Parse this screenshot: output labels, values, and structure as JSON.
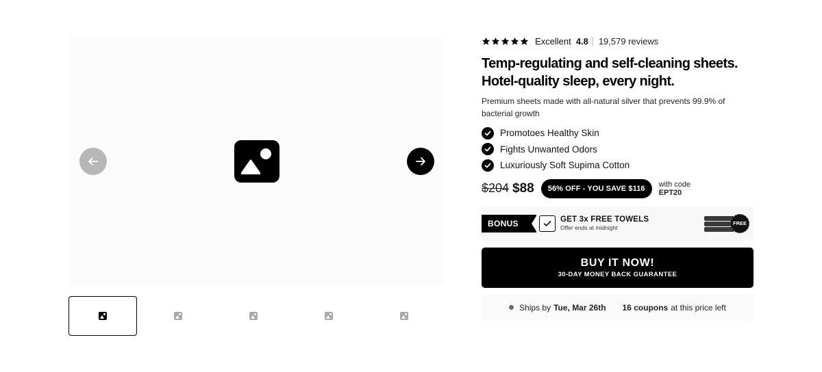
{
  "gallery": {
    "thumbnails": [
      {
        "active": true
      },
      {
        "active": false
      },
      {
        "active": false
      },
      {
        "active": false
      },
      {
        "active": false
      }
    ]
  },
  "rating": {
    "stars": 5,
    "word": "Excellent",
    "score": "4.8",
    "count": "19,579 reviews"
  },
  "product": {
    "title_line1": "Temp-regulating and self-cleaning sheets.",
    "title_line2": "Hotel-quality sleep, every night.",
    "subtitle": "Premium sheets made with all-natural silver that prevents 99.9% of bacterial growth",
    "benefits": [
      "Promotoes Healthy Skin",
      "Fights Unwanted Odors",
      "Luxuriously Soft Supima Cotton"
    ]
  },
  "pricing": {
    "old_price": "$204",
    "new_price": "$88",
    "savings": "56% OFF - YOU SAVE $116",
    "code_prefix": "with code",
    "code": "EPT20"
  },
  "bonus": {
    "tag": "BONUS",
    "checked": true,
    "title": "GET 3x FREE TOWELS",
    "subtitle": "Offer ends at midnight",
    "badge": "FREE"
  },
  "cta": {
    "label": "BUY IT NOW!",
    "sublabel": "30-DAY MONEY BACK GUARANTEE"
  },
  "shipping": {
    "prefix": "Ships by",
    "date": "Tue, Mar 26th",
    "coupons_count": "16 coupons",
    "coupons_suffix": "at this price left"
  },
  "colors": {
    "primary": "#000000",
    "nav_prev": "#b7b7b7",
    "background_panel": "#f8f8f8"
  }
}
